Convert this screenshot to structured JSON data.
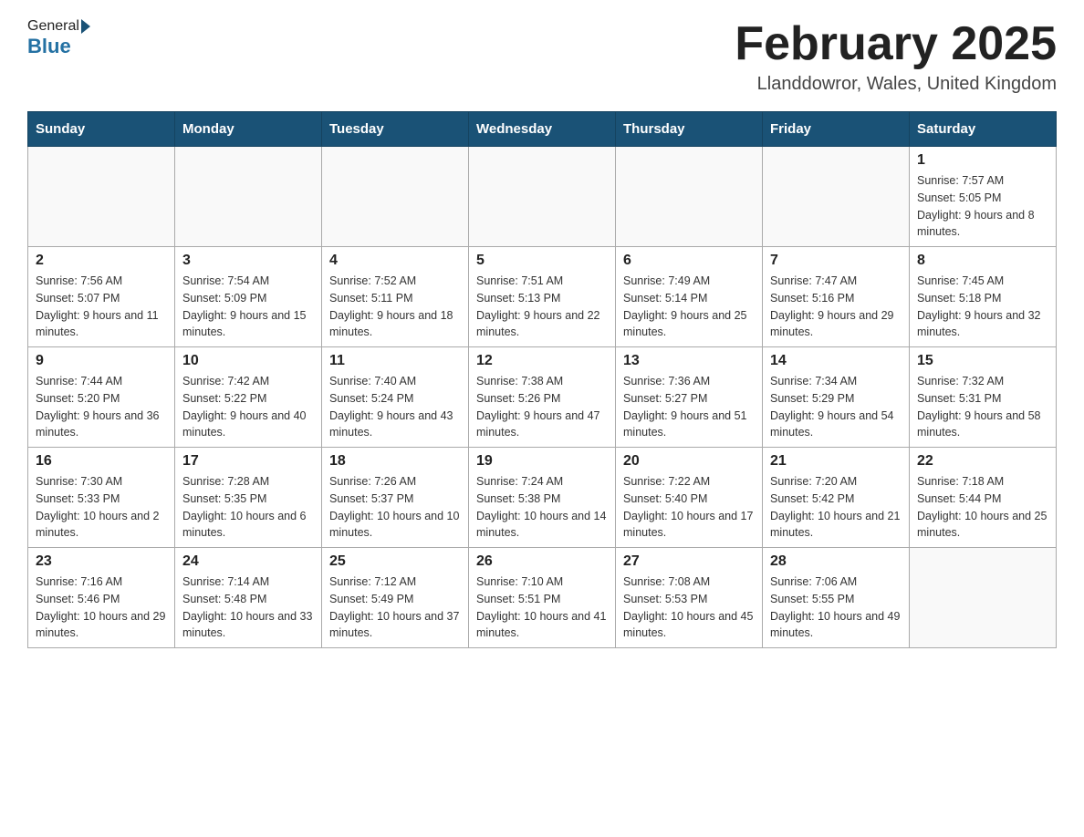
{
  "header": {
    "logo_general": "General",
    "logo_blue": "Blue",
    "month_title": "February 2025",
    "location": "Llanddowror, Wales, United Kingdom"
  },
  "days_of_week": [
    "Sunday",
    "Monday",
    "Tuesday",
    "Wednesday",
    "Thursday",
    "Friday",
    "Saturday"
  ],
  "weeks": [
    [
      {
        "day": "",
        "info": ""
      },
      {
        "day": "",
        "info": ""
      },
      {
        "day": "",
        "info": ""
      },
      {
        "day": "",
        "info": ""
      },
      {
        "day": "",
        "info": ""
      },
      {
        "day": "",
        "info": ""
      },
      {
        "day": "1",
        "info": "Sunrise: 7:57 AM\nSunset: 5:05 PM\nDaylight: 9 hours and 8 minutes."
      }
    ],
    [
      {
        "day": "2",
        "info": "Sunrise: 7:56 AM\nSunset: 5:07 PM\nDaylight: 9 hours and 11 minutes."
      },
      {
        "day": "3",
        "info": "Sunrise: 7:54 AM\nSunset: 5:09 PM\nDaylight: 9 hours and 15 minutes."
      },
      {
        "day": "4",
        "info": "Sunrise: 7:52 AM\nSunset: 5:11 PM\nDaylight: 9 hours and 18 minutes."
      },
      {
        "day": "5",
        "info": "Sunrise: 7:51 AM\nSunset: 5:13 PM\nDaylight: 9 hours and 22 minutes."
      },
      {
        "day": "6",
        "info": "Sunrise: 7:49 AM\nSunset: 5:14 PM\nDaylight: 9 hours and 25 minutes."
      },
      {
        "day": "7",
        "info": "Sunrise: 7:47 AM\nSunset: 5:16 PM\nDaylight: 9 hours and 29 minutes."
      },
      {
        "day": "8",
        "info": "Sunrise: 7:45 AM\nSunset: 5:18 PM\nDaylight: 9 hours and 32 minutes."
      }
    ],
    [
      {
        "day": "9",
        "info": "Sunrise: 7:44 AM\nSunset: 5:20 PM\nDaylight: 9 hours and 36 minutes."
      },
      {
        "day": "10",
        "info": "Sunrise: 7:42 AM\nSunset: 5:22 PM\nDaylight: 9 hours and 40 minutes."
      },
      {
        "day": "11",
        "info": "Sunrise: 7:40 AM\nSunset: 5:24 PM\nDaylight: 9 hours and 43 minutes."
      },
      {
        "day": "12",
        "info": "Sunrise: 7:38 AM\nSunset: 5:26 PM\nDaylight: 9 hours and 47 minutes."
      },
      {
        "day": "13",
        "info": "Sunrise: 7:36 AM\nSunset: 5:27 PM\nDaylight: 9 hours and 51 minutes."
      },
      {
        "day": "14",
        "info": "Sunrise: 7:34 AM\nSunset: 5:29 PM\nDaylight: 9 hours and 54 minutes."
      },
      {
        "day": "15",
        "info": "Sunrise: 7:32 AM\nSunset: 5:31 PM\nDaylight: 9 hours and 58 minutes."
      }
    ],
    [
      {
        "day": "16",
        "info": "Sunrise: 7:30 AM\nSunset: 5:33 PM\nDaylight: 10 hours and 2 minutes."
      },
      {
        "day": "17",
        "info": "Sunrise: 7:28 AM\nSunset: 5:35 PM\nDaylight: 10 hours and 6 minutes."
      },
      {
        "day": "18",
        "info": "Sunrise: 7:26 AM\nSunset: 5:37 PM\nDaylight: 10 hours and 10 minutes."
      },
      {
        "day": "19",
        "info": "Sunrise: 7:24 AM\nSunset: 5:38 PM\nDaylight: 10 hours and 14 minutes."
      },
      {
        "day": "20",
        "info": "Sunrise: 7:22 AM\nSunset: 5:40 PM\nDaylight: 10 hours and 17 minutes."
      },
      {
        "day": "21",
        "info": "Sunrise: 7:20 AM\nSunset: 5:42 PM\nDaylight: 10 hours and 21 minutes."
      },
      {
        "day": "22",
        "info": "Sunrise: 7:18 AM\nSunset: 5:44 PM\nDaylight: 10 hours and 25 minutes."
      }
    ],
    [
      {
        "day": "23",
        "info": "Sunrise: 7:16 AM\nSunset: 5:46 PM\nDaylight: 10 hours and 29 minutes."
      },
      {
        "day": "24",
        "info": "Sunrise: 7:14 AM\nSunset: 5:48 PM\nDaylight: 10 hours and 33 minutes."
      },
      {
        "day": "25",
        "info": "Sunrise: 7:12 AM\nSunset: 5:49 PM\nDaylight: 10 hours and 37 minutes."
      },
      {
        "day": "26",
        "info": "Sunrise: 7:10 AM\nSunset: 5:51 PM\nDaylight: 10 hours and 41 minutes."
      },
      {
        "day": "27",
        "info": "Sunrise: 7:08 AM\nSunset: 5:53 PM\nDaylight: 10 hours and 45 minutes."
      },
      {
        "day": "28",
        "info": "Sunrise: 7:06 AM\nSunset: 5:55 PM\nDaylight: 10 hours and 49 minutes."
      },
      {
        "day": "",
        "info": ""
      }
    ]
  ]
}
